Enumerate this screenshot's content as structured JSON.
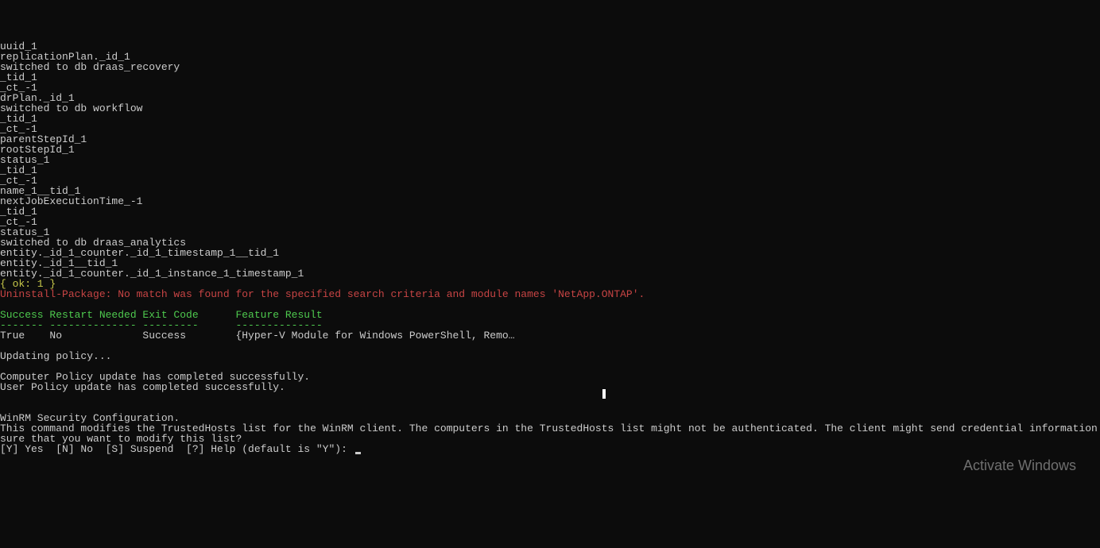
{
  "terminal": {
    "lines": [
      {
        "text": "uuid_1",
        "class": "white"
      },
      {
        "text": "replicationPlan._id_1",
        "class": "white"
      },
      {
        "text": "switched to db draas_recovery",
        "class": "white"
      },
      {
        "text": "_tid_1",
        "class": "white"
      },
      {
        "text": "_ct_-1",
        "class": "white"
      },
      {
        "text": "drPlan._id_1",
        "class": "white"
      },
      {
        "text": "switched to db workflow",
        "class": "white"
      },
      {
        "text": "_tid_1",
        "class": "white"
      },
      {
        "text": "_ct_-1",
        "class": "white"
      },
      {
        "text": "parentStepId_1",
        "class": "white"
      },
      {
        "text": "rootStepId_1",
        "class": "white"
      },
      {
        "text": "status_1",
        "class": "white"
      },
      {
        "text": "_tid_1",
        "class": "white"
      },
      {
        "text": "_ct_-1",
        "class": "white"
      },
      {
        "text": "name_1__tid_1",
        "class": "white"
      },
      {
        "text": "nextJobExecutionTime_-1",
        "class": "white"
      },
      {
        "text": "_tid_1",
        "class": "white"
      },
      {
        "text": "_ct_-1",
        "class": "white"
      },
      {
        "text": "status_1",
        "class": "white"
      },
      {
        "text": "switched to db draas_analytics",
        "class": "white"
      },
      {
        "text": "entity._id_1_counter._id_1_timestamp_1__tid_1",
        "class": "white"
      },
      {
        "text": "entity._id_1__tid_1",
        "class": "white"
      },
      {
        "text": "entity._id_1_counter._id_1_instance_1_timestamp_1",
        "class": "white"
      },
      {
        "text": "{ ok: 1 }",
        "class": "yellow"
      },
      {
        "text": "Uninstall-Package: No match was found for the specified search criteria and module names 'NetApp.ONTAP'.",
        "class": "red"
      },
      {
        "text": "",
        "class": "white"
      },
      {
        "text": "Success Restart Needed Exit Code      Feature Result",
        "class": "green"
      },
      {
        "text": "------- -------------- ---------      --------------",
        "class": "green"
      },
      {
        "text": "True    No             Success        {Hyper-V Module for Windows PowerShell, Remo…",
        "class": "white"
      },
      {
        "text": "",
        "class": "white"
      },
      {
        "text": "Updating policy...",
        "class": "white"
      },
      {
        "text": "",
        "class": "white"
      },
      {
        "text": "Computer Policy update has completed successfully.",
        "class": "white"
      },
      {
        "text": "User Policy update has completed successfully.",
        "class": "white"
      },
      {
        "text": "",
        "class": "white"
      },
      {
        "text": "",
        "class": "white"
      },
      {
        "text": "WinRM Security Configuration.",
        "class": "white"
      },
      {
        "text": "This command modifies the TrustedHosts list for the WinRM client. The computers in the TrustedHosts list might not be authenticated. The client might send credential information to these computers. Are you",
        "class": "white"
      },
      {
        "text": "sure that you want to modify this list?",
        "class": "white"
      }
    ],
    "prompt": "[Y] Yes  [N] No  [S] Suspend  [?] Help (default is \"Y\"): "
  },
  "watermark": {
    "line1": "Activate Windows"
  }
}
